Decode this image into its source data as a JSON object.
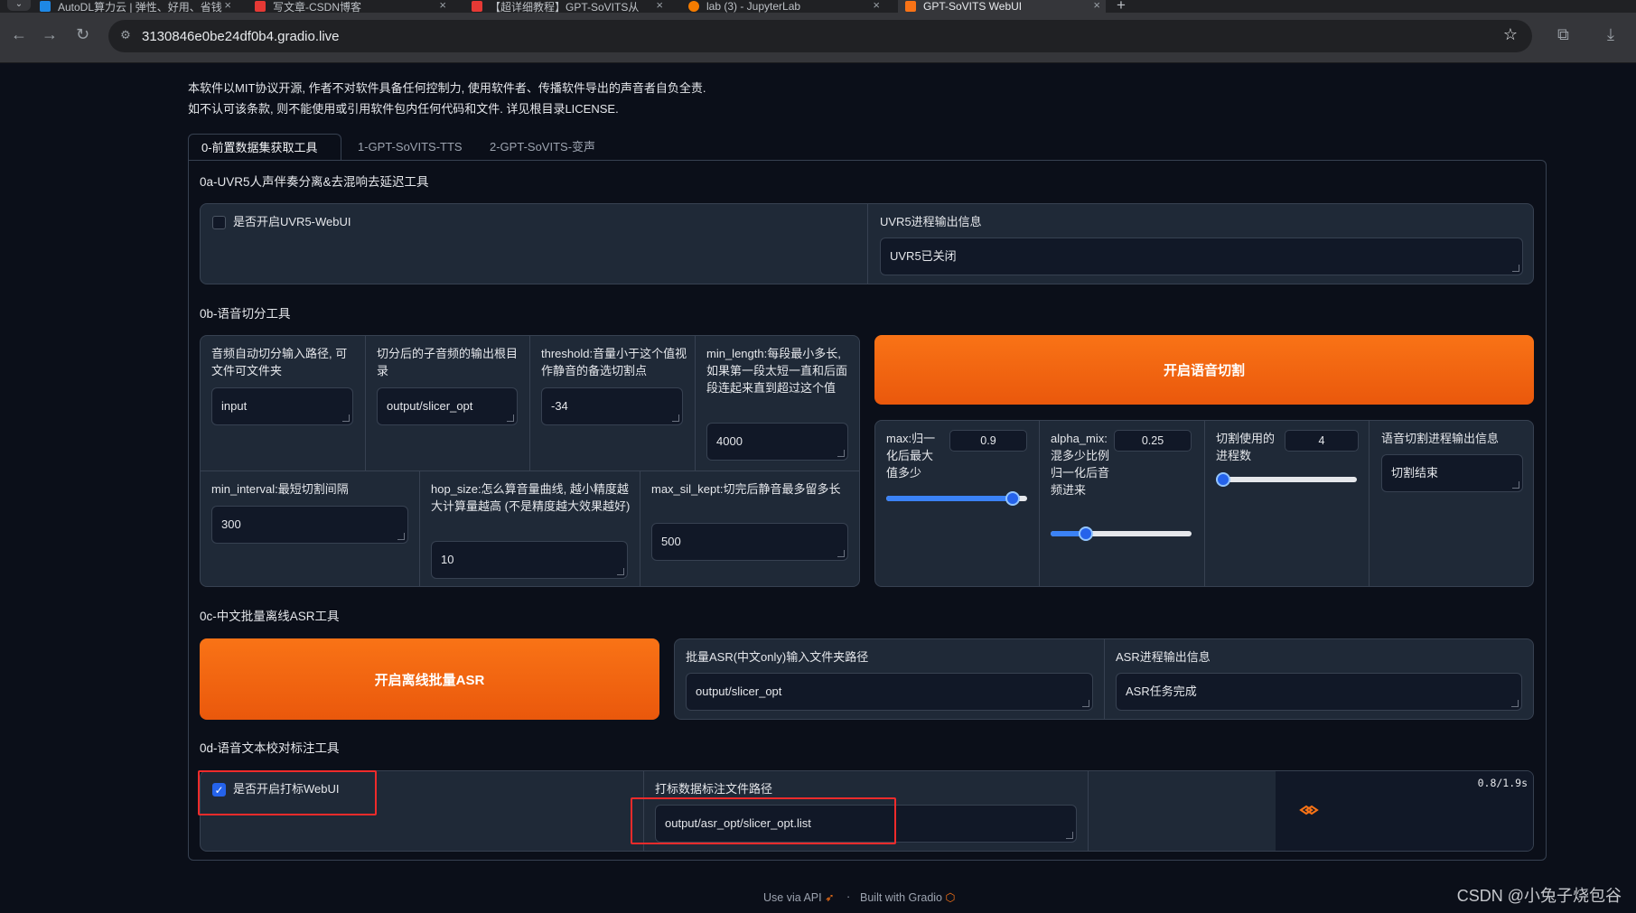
{
  "browser": {
    "tabs": [
      {
        "title": "AutoDL算力云 | 弹性、好用、省钱",
        "active": false
      },
      {
        "title": "写文章-CSDN博客",
        "active": false
      },
      {
        "title": "【超详细教程】GPT-SoVITS从",
        "active": false
      },
      {
        "title": "lab (3) - JupyterLab",
        "active": false
      },
      {
        "title": "GPT-SoVITS WebUI",
        "active": true
      }
    ],
    "url": "3130846e0be24df0b4.gradio.live"
  },
  "notice": {
    "line1": "本软件以MIT协议开源, 作者不对软件具备任何控制力, 使用软件者、传播软件导出的声音者自负全责.",
    "line2": "如不认可该条款, 则不能使用或引用软件包内任何代码和文件. 详见根目录LICENSE."
  },
  "tabs": [
    "0-前置数据集获取工具",
    "1-GPT-SoVITS-TTS",
    "2-GPT-SoVITS-变声"
  ],
  "uvr5": {
    "title": "0a-UVR5人声伴奏分离&去混响去延迟工具",
    "checkbox_label": "是否开启UVR5-WebUI",
    "checked": false,
    "output_label": "UVR5进程输出信息",
    "output_value": "UVR5已关闭"
  },
  "slicer": {
    "title": "0b-语音切分工具",
    "input_path_label": "音频自动切分输入路径, 可文件可文件夹",
    "input_path_value": "input",
    "output_dir_label": "切分后的子音频的输出根目录",
    "output_dir_value": "output/slicer_opt",
    "threshold_label": "threshold:音量小于这个值视作静音的备选切割点",
    "threshold_value": "-34",
    "min_length_label": "min_length:每段最小多长, 如果第一段太短一直和后面段连起来直到超过这个值",
    "min_length_value": "4000",
    "min_interval_label": "min_interval:最短切割间隔",
    "min_interval_value": "300",
    "hop_size_label": "hop_size:怎么算音量曲线, 越小精度越大计算量越高 (不是精度越大效果越好)",
    "hop_size_value": "10",
    "max_sil_kept_label": "max_sil_kept:切完后静音最多留多长",
    "max_sil_kept_value": "500",
    "start_button": "开启语音切割",
    "max_label": "max:归一化后最大值多少",
    "max_value": "0.9",
    "max_fraction": 0.9,
    "alpha_label": "alpha_mix:混多少比例归一化后音频进来",
    "alpha_value": "0.25",
    "alpha_fraction": 0.25,
    "procs_label": "切割使用的进程数",
    "procs_value": "4",
    "procs_fraction": 0.0,
    "output_label": "语音切割进程输出信息",
    "output_value": "切割结束"
  },
  "asr": {
    "title": "0c-中文批量离线ASR工具",
    "start_button": "开启离线批量ASR",
    "input_label": "批量ASR(中文only)输入文件夹路径",
    "input_value": "output/slicer_opt",
    "output_label": "ASR进程输出信息",
    "output_value": "ASR任务完成"
  },
  "label_tool": {
    "title": "0d-语音文本校对标注工具",
    "checkbox_label": "是否开启打标WebUI",
    "checked": true,
    "path_label": "打标数据标注文件路径",
    "path_value": "output/asr_opt/slicer_opt.list",
    "timer": "0.8/1.9s"
  },
  "footer": {
    "api": "Use via API",
    "built": "Built with Gradio"
  },
  "watermark": "CSDN @小兔子烧包谷",
  "colors": {
    "accent_orange": "#f97316",
    "slider_blue": "#3b82f6",
    "highlight_red": "#ef2b2b"
  }
}
